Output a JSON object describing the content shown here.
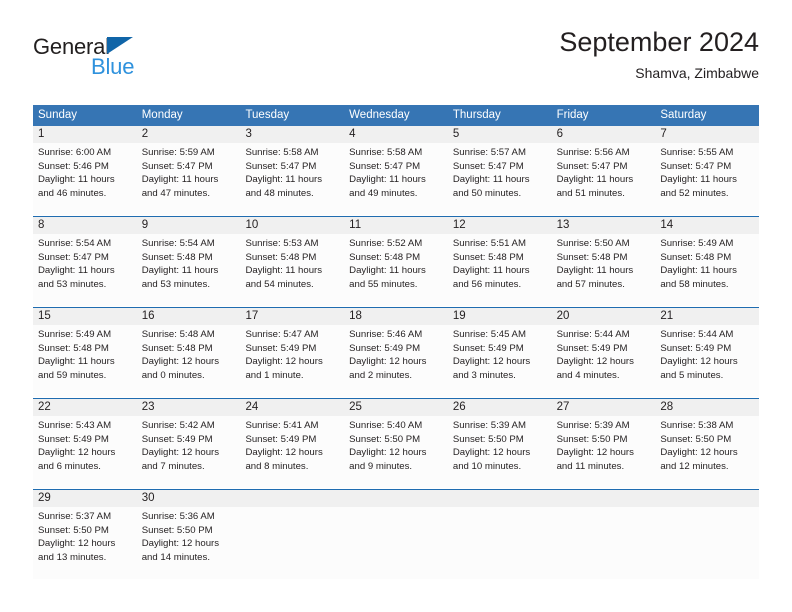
{
  "branding": {
    "logo_text_primary": "General",
    "logo_text_secondary": "Blue",
    "logo_primary_color": "#221f1f",
    "logo_secondary_color": "#2f92dd",
    "logo_triangle_color": "#1065a8"
  },
  "header": {
    "title": "September 2024",
    "subtitle": "Shamva, Zimbabwe"
  },
  "theme": {
    "header_row_bg": "#3675b4",
    "header_row_text": "#ffffff",
    "daynum_band_bg": "#f0f0f0",
    "cell_bg": "#fcfcfc",
    "week_separator": "#1f6cb0",
    "text_color": "#231f20"
  },
  "weekdays": [
    "Sunday",
    "Monday",
    "Tuesday",
    "Wednesday",
    "Thursday",
    "Friday",
    "Saturday"
  ],
  "weeks": [
    [
      {
        "day": "1",
        "sunrise": "Sunrise: 6:00 AM",
        "sunset": "Sunset: 5:46 PM",
        "daylight_line1": "Daylight: 11 hours",
        "daylight_line2": "and 46 minutes."
      },
      {
        "day": "2",
        "sunrise": "Sunrise: 5:59 AM",
        "sunset": "Sunset: 5:47 PM",
        "daylight_line1": "Daylight: 11 hours",
        "daylight_line2": "and 47 minutes."
      },
      {
        "day": "3",
        "sunrise": "Sunrise: 5:58 AM",
        "sunset": "Sunset: 5:47 PM",
        "daylight_line1": "Daylight: 11 hours",
        "daylight_line2": "and 48 minutes."
      },
      {
        "day": "4",
        "sunrise": "Sunrise: 5:58 AM",
        "sunset": "Sunset: 5:47 PM",
        "daylight_line1": "Daylight: 11 hours",
        "daylight_line2": "and 49 minutes."
      },
      {
        "day": "5",
        "sunrise": "Sunrise: 5:57 AM",
        "sunset": "Sunset: 5:47 PM",
        "daylight_line1": "Daylight: 11 hours",
        "daylight_line2": "and 50 minutes."
      },
      {
        "day": "6",
        "sunrise": "Sunrise: 5:56 AM",
        "sunset": "Sunset: 5:47 PM",
        "daylight_line1": "Daylight: 11 hours",
        "daylight_line2": "and 51 minutes."
      },
      {
        "day": "7",
        "sunrise": "Sunrise: 5:55 AM",
        "sunset": "Sunset: 5:47 PM",
        "daylight_line1": "Daylight: 11 hours",
        "daylight_line2": "and 52 minutes."
      }
    ],
    [
      {
        "day": "8",
        "sunrise": "Sunrise: 5:54 AM",
        "sunset": "Sunset: 5:47 PM",
        "daylight_line1": "Daylight: 11 hours",
        "daylight_line2": "and 53 minutes."
      },
      {
        "day": "9",
        "sunrise": "Sunrise: 5:54 AM",
        "sunset": "Sunset: 5:48 PM",
        "daylight_line1": "Daylight: 11 hours",
        "daylight_line2": "and 53 minutes."
      },
      {
        "day": "10",
        "sunrise": "Sunrise: 5:53 AM",
        "sunset": "Sunset: 5:48 PM",
        "daylight_line1": "Daylight: 11 hours",
        "daylight_line2": "and 54 minutes."
      },
      {
        "day": "11",
        "sunrise": "Sunrise: 5:52 AM",
        "sunset": "Sunset: 5:48 PM",
        "daylight_line1": "Daylight: 11 hours",
        "daylight_line2": "and 55 minutes."
      },
      {
        "day": "12",
        "sunrise": "Sunrise: 5:51 AM",
        "sunset": "Sunset: 5:48 PM",
        "daylight_line1": "Daylight: 11 hours",
        "daylight_line2": "and 56 minutes."
      },
      {
        "day": "13",
        "sunrise": "Sunrise: 5:50 AM",
        "sunset": "Sunset: 5:48 PM",
        "daylight_line1": "Daylight: 11 hours",
        "daylight_line2": "and 57 minutes."
      },
      {
        "day": "14",
        "sunrise": "Sunrise: 5:49 AM",
        "sunset": "Sunset: 5:48 PM",
        "daylight_line1": "Daylight: 11 hours",
        "daylight_line2": "and 58 minutes."
      }
    ],
    [
      {
        "day": "15",
        "sunrise": "Sunrise: 5:49 AM",
        "sunset": "Sunset: 5:48 PM",
        "daylight_line1": "Daylight: 11 hours",
        "daylight_line2": "and 59 minutes."
      },
      {
        "day": "16",
        "sunrise": "Sunrise: 5:48 AM",
        "sunset": "Sunset: 5:48 PM",
        "daylight_line1": "Daylight: 12 hours",
        "daylight_line2": "and 0 minutes."
      },
      {
        "day": "17",
        "sunrise": "Sunrise: 5:47 AM",
        "sunset": "Sunset: 5:49 PM",
        "daylight_line1": "Daylight: 12 hours",
        "daylight_line2": "and 1 minute."
      },
      {
        "day": "18",
        "sunrise": "Sunrise: 5:46 AM",
        "sunset": "Sunset: 5:49 PM",
        "daylight_line1": "Daylight: 12 hours",
        "daylight_line2": "and 2 minutes."
      },
      {
        "day": "19",
        "sunrise": "Sunrise: 5:45 AM",
        "sunset": "Sunset: 5:49 PM",
        "daylight_line1": "Daylight: 12 hours",
        "daylight_line2": "and 3 minutes."
      },
      {
        "day": "20",
        "sunrise": "Sunrise: 5:44 AM",
        "sunset": "Sunset: 5:49 PM",
        "daylight_line1": "Daylight: 12 hours",
        "daylight_line2": "and 4 minutes."
      },
      {
        "day": "21",
        "sunrise": "Sunrise: 5:44 AM",
        "sunset": "Sunset: 5:49 PM",
        "daylight_line1": "Daylight: 12 hours",
        "daylight_line2": "and 5 minutes."
      }
    ],
    [
      {
        "day": "22",
        "sunrise": "Sunrise: 5:43 AM",
        "sunset": "Sunset: 5:49 PM",
        "daylight_line1": "Daylight: 12 hours",
        "daylight_line2": "and 6 minutes."
      },
      {
        "day": "23",
        "sunrise": "Sunrise: 5:42 AM",
        "sunset": "Sunset: 5:49 PM",
        "daylight_line1": "Daylight: 12 hours",
        "daylight_line2": "and 7 minutes."
      },
      {
        "day": "24",
        "sunrise": "Sunrise: 5:41 AM",
        "sunset": "Sunset: 5:49 PM",
        "daylight_line1": "Daylight: 12 hours",
        "daylight_line2": "and 8 minutes."
      },
      {
        "day": "25",
        "sunrise": "Sunrise: 5:40 AM",
        "sunset": "Sunset: 5:50 PM",
        "daylight_line1": "Daylight: 12 hours",
        "daylight_line2": "and 9 minutes."
      },
      {
        "day": "26",
        "sunrise": "Sunrise: 5:39 AM",
        "sunset": "Sunset: 5:50 PM",
        "daylight_line1": "Daylight: 12 hours",
        "daylight_line2": "and 10 minutes."
      },
      {
        "day": "27",
        "sunrise": "Sunrise: 5:39 AM",
        "sunset": "Sunset: 5:50 PM",
        "daylight_line1": "Daylight: 12 hours",
        "daylight_line2": "and 11 minutes."
      },
      {
        "day": "28",
        "sunrise": "Sunrise: 5:38 AM",
        "sunset": "Sunset: 5:50 PM",
        "daylight_line1": "Daylight: 12 hours",
        "daylight_line2": "and 12 minutes."
      }
    ],
    [
      {
        "day": "29",
        "sunrise": "Sunrise: 5:37 AM",
        "sunset": "Sunset: 5:50 PM",
        "daylight_line1": "Daylight: 12 hours",
        "daylight_line2": "and 13 minutes."
      },
      {
        "day": "30",
        "sunrise": "Sunrise: 5:36 AM",
        "sunset": "Sunset: 5:50 PM",
        "daylight_line1": "Daylight: 12 hours",
        "daylight_line2": "and 14 minutes."
      },
      {
        "day": "",
        "sunrise": "",
        "sunset": "",
        "daylight_line1": "",
        "daylight_line2": ""
      },
      {
        "day": "",
        "sunrise": "",
        "sunset": "",
        "daylight_line1": "",
        "daylight_line2": ""
      },
      {
        "day": "",
        "sunrise": "",
        "sunset": "",
        "daylight_line1": "",
        "daylight_line2": ""
      },
      {
        "day": "",
        "sunrise": "",
        "sunset": "",
        "daylight_line1": "",
        "daylight_line2": ""
      },
      {
        "day": "",
        "sunrise": "",
        "sunset": "",
        "daylight_line1": "",
        "daylight_line2": ""
      }
    ]
  ]
}
